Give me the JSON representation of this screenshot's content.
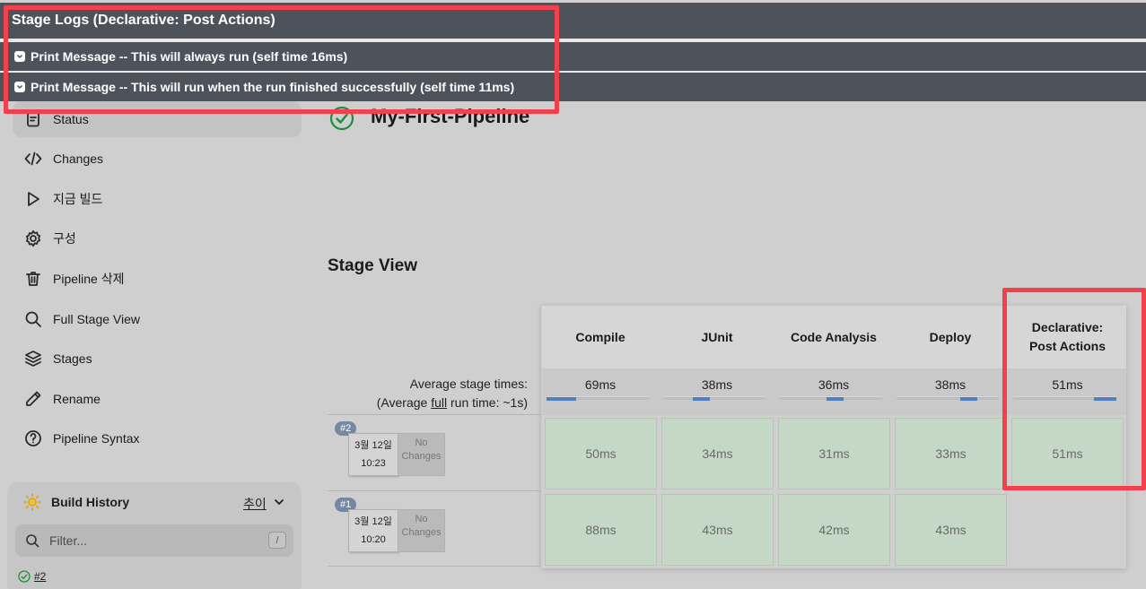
{
  "logs": {
    "title": "Stage Logs (Declarative: Post Actions)",
    "lines": [
      "Print Message -- This will always run (self time 16ms)",
      "Print Message -- This will run when the run finished successfully (self time 11ms)"
    ]
  },
  "sidebar": {
    "items": [
      {
        "label": "Status",
        "icon": "status-icon"
      },
      {
        "label": "Changes",
        "icon": "code-icon"
      },
      {
        "label": "지금 빌드",
        "icon": "play-icon"
      },
      {
        "label": "구성",
        "icon": "gear-icon"
      },
      {
        "label": "Pipeline 삭제",
        "icon": "trash-icon"
      },
      {
        "label": "Full Stage View",
        "icon": "search-icon"
      },
      {
        "label": "Stages",
        "icon": "layers-icon"
      },
      {
        "label": "Rename",
        "icon": "pencil-icon"
      },
      {
        "label": "Pipeline Syntax",
        "icon": "help-icon"
      }
    ]
  },
  "build_history": {
    "title": "Build History",
    "trend_label": "추이",
    "filter_placeholder": "Filter...",
    "filter_shortcut": "/",
    "first_build": "#2"
  },
  "job": {
    "title": "My-First-Pipeline"
  },
  "stage_view": {
    "title": "Stage View",
    "avg_label_line1": "Average stage times:",
    "avg_label_prefix": "(Average ",
    "avg_label_link": "full",
    "avg_label_suffix": " run time: ~1s)",
    "stages": [
      {
        "name_lines": [
          "Compile"
        ],
        "avg": "69ms",
        "bar_start": 0.0,
        "bar_fraction": 0.29
      },
      {
        "name_lines": [
          "JUnit"
        ],
        "avg": "38ms",
        "bar_start": 0.29,
        "bar_fraction": 0.17
      },
      {
        "name_lines": [
          "Code Analysis"
        ],
        "avg": "36ms",
        "bar_start": 0.46,
        "bar_fraction": 0.16
      },
      {
        "name_lines": [
          "Deploy"
        ],
        "avg": "38ms",
        "bar_start": 0.62,
        "bar_fraction": 0.17
      },
      {
        "name_lines": [
          "Declarative:",
          "Post Actions"
        ],
        "avg": "51ms",
        "bar_start": 0.78,
        "bar_fraction": 0.22
      }
    ],
    "runs": [
      {
        "badge": "#2",
        "date": "3월 12일",
        "time": "10:23",
        "changes_line1": "No",
        "changes_line2": "Changes",
        "durations": [
          "50ms",
          "34ms",
          "31ms",
          "33ms",
          "51ms"
        ]
      },
      {
        "badge": "#1",
        "date": "3월 12일",
        "time": "10:20",
        "changes_line1": "No",
        "changes_line2": "Changes",
        "durations": [
          "88ms",
          "43ms",
          "42ms",
          "43ms",
          ""
        ]
      }
    ]
  },
  "colors": {
    "log_bg": "#4e525b",
    "highlight": "#f2404d",
    "success_cell": "#c5d8c5",
    "progress": "#5080c0"
  }
}
